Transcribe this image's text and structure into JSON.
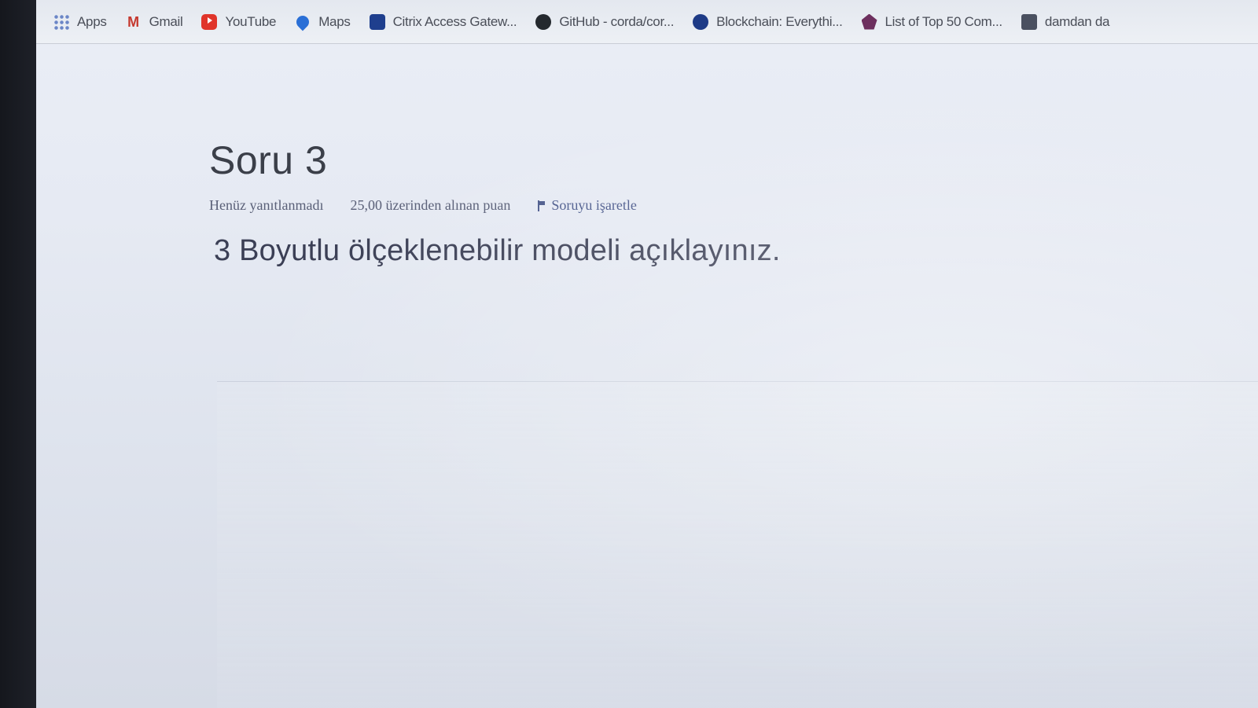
{
  "bookmarks": [
    {
      "label": "Apps",
      "icon": "apps-grid-icon"
    },
    {
      "label": "Gmail",
      "icon": "gmail-icon"
    },
    {
      "label": "YouTube",
      "icon": "youtube-icon"
    },
    {
      "label": "Maps",
      "icon": "maps-pin-icon"
    },
    {
      "label": "Citrix Access Gatew...",
      "icon": "citrix-icon"
    },
    {
      "label": "GitHub - corda/cor...",
      "icon": "github-icon"
    },
    {
      "label": "Blockchain: Everythi...",
      "icon": "blockchain-icon"
    },
    {
      "label": "List of Top 50 Com...",
      "icon": "list-icon"
    },
    {
      "label": "damdan da",
      "icon": "document-icon"
    }
  ],
  "question": {
    "title": "Soru 3",
    "status": "Henüz yanıtlanmadı",
    "points": "25,00 üzerinden alınan puan",
    "flag_label": "Soruyu işaretle",
    "text": "3 Boyutlu ölçeklenebilir modeli açıklayınız."
  }
}
